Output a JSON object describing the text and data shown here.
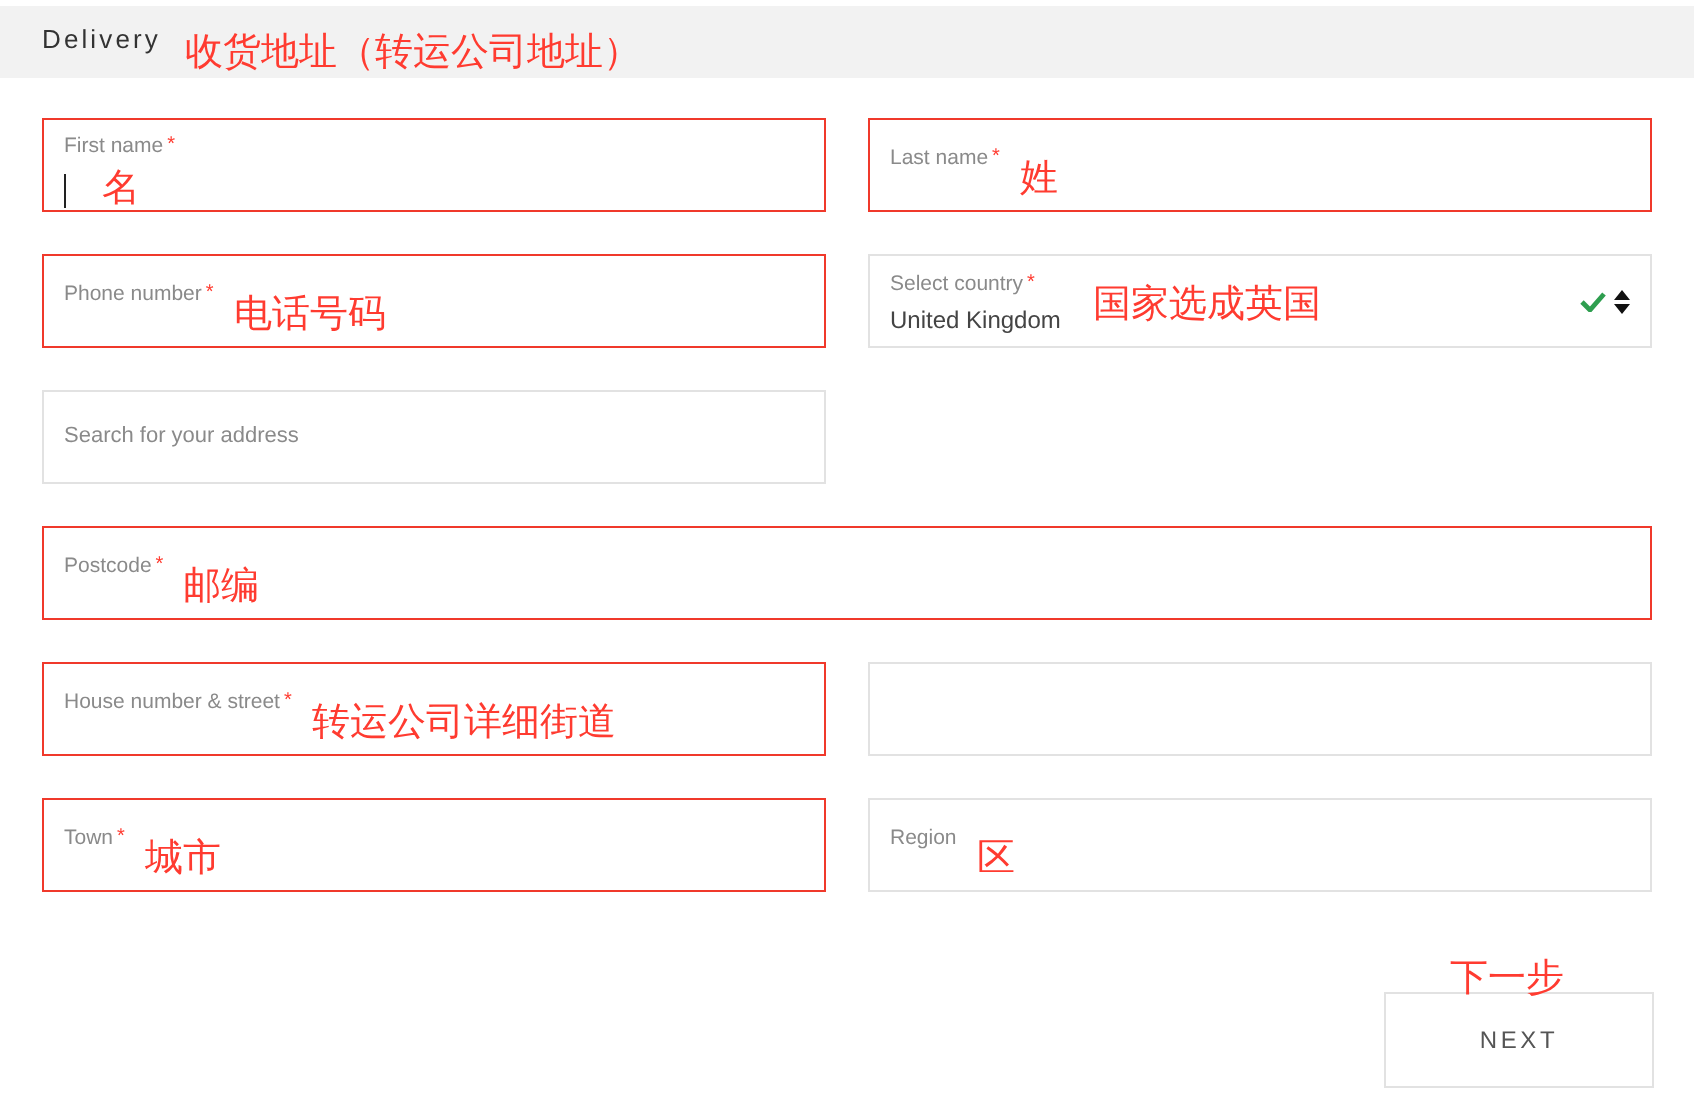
{
  "header": {
    "title": "Delivery",
    "note": "收货地址（转运公司地址）"
  },
  "fields": [
    {
      "kind": "text",
      "label": "First name",
      "required": "*",
      "invalid": true,
      "focused": true,
      "note": "名"
    },
    {
      "kind": "text",
      "label": "Last name",
      "required": "*",
      "invalid": true,
      "focused": false,
      "note": "姓"
    },
    {
      "kind": "text",
      "label": "Phone number",
      "required": "*",
      "invalid": true,
      "focused": false,
      "note": "电话号码"
    },
    {
      "kind": "select",
      "label": "Select country",
      "required": "*",
      "invalid": false,
      "value": "United Kingdom",
      "valid": true,
      "note": "国家选成英国"
    },
    {
      "kind": "search",
      "placeholder": "Search for your address",
      "invalid": false
    },
    {
      "kind": "text",
      "label": "Postcode",
      "required": "*",
      "invalid": true,
      "focused": false,
      "wide": true,
      "note": "邮编"
    },
    {
      "kind": "text",
      "label": "House number & street",
      "required": "*",
      "invalid": true,
      "focused": false,
      "note": "转运公司详细街道"
    },
    {
      "kind": "blank",
      "invalid": false
    },
    {
      "kind": "text",
      "label": "Town",
      "required": "*",
      "invalid": true,
      "focused": false,
      "note": "城市"
    },
    {
      "kind": "text",
      "label": "Region",
      "invalid": false,
      "focused": false,
      "note": "区"
    }
  ],
  "next_button": {
    "label": "NEXT",
    "note": "下一步"
  }
}
